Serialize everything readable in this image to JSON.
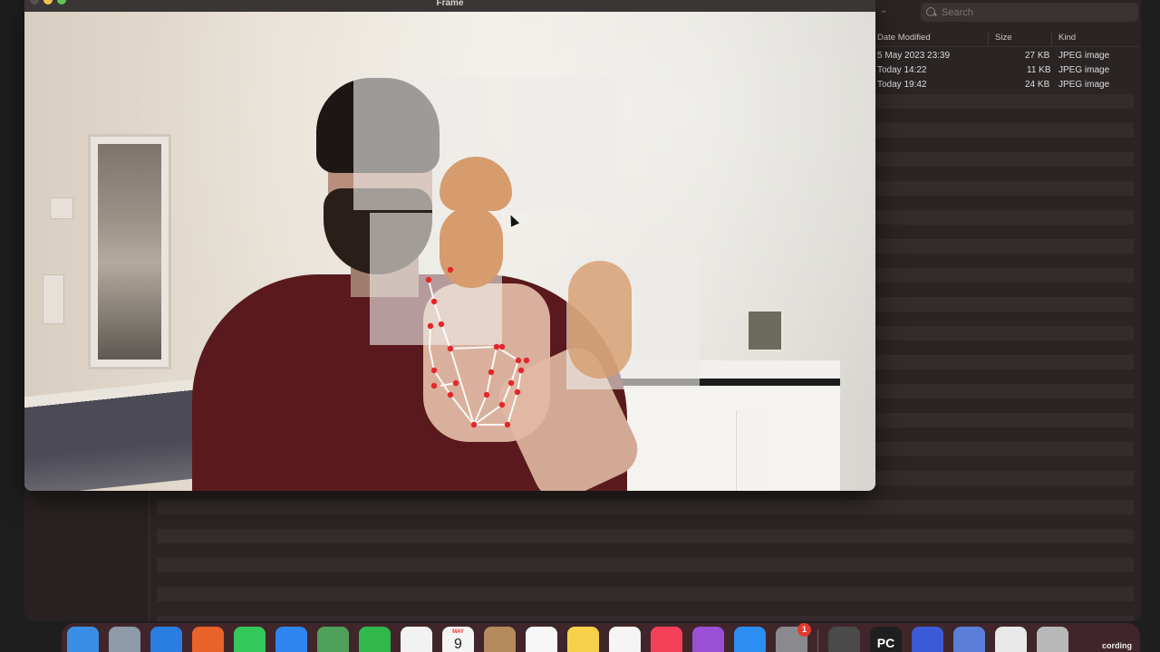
{
  "finder": {
    "search_placeholder": "Search",
    "columns": {
      "date_modified": "Date Modified",
      "size": "Size",
      "kind": "Kind"
    },
    "files": [
      {
        "date": "5 May 2023 23:39",
        "size": "27 KB",
        "kind": "JPEG image"
      },
      {
        "date": "Today 14:22",
        "size": "11 KB",
        "kind": "JPEG image"
      },
      {
        "date": "Today 19:42",
        "size": "24 KB",
        "kind": "JPEG image"
      }
    ]
  },
  "frame_window": {
    "title": "Frame"
  },
  "dock": {
    "items": [
      {
        "name": "finder",
        "color": "#3a8ee6"
      },
      {
        "name": "launchpad",
        "color": "#8d9aa8"
      },
      {
        "name": "safari",
        "color": "#2a7de1"
      },
      {
        "name": "firefox",
        "color": "#e8622a"
      },
      {
        "name": "messages",
        "color": "#34c759"
      },
      {
        "name": "mail",
        "color": "#2e86f0"
      },
      {
        "name": "maps",
        "color": "#4ea05a"
      },
      {
        "name": "facetime",
        "color": "#30b84a"
      },
      {
        "name": "photos",
        "color": "#f2f2f2"
      },
      {
        "name": "calendar",
        "color": "#f4f4f4"
      },
      {
        "name": "contacts",
        "color": "#b58a5c"
      },
      {
        "name": "reminders",
        "color": "#f6f6f6"
      },
      {
        "name": "notes",
        "color": "#f7d14a"
      },
      {
        "name": "freeform",
        "color": "#f5f5f5"
      },
      {
        "name": "music",
        "color": "#f5405a"
      },
      {
        "name": "podcasts",
        "color": "#9b4fd6"
      },
      {
        "name": "app-store",
        "color": "#2b8ef0"
      },
      {
        "name": "system-settings",
        "color": "#8a8a8e"
      },
      {
        "name": "sublime-text",
        "color": "#4a4a4a"
      },
      {
        "name": "pycharm",
        "color": "#1f1f1f"
      },
      {
        "name": "firefox-developer",
        "color": "#3b5bd6"
      },
      {
        "name": "pencil-app",
        "color": "#5b7fd8"
      },
      {
        "name": "documents",
        "color": "#e8e8e8"
      },
      {
        "name": "trash",
        "color": "#b8b8b8"
      }
    ],
    "calendar_month": "MAY",
    "calendar_day": "9",
    "settings_badge": "1",
    "pycharm_label": "PC",
    "recording_label": "cording"
  }
}
